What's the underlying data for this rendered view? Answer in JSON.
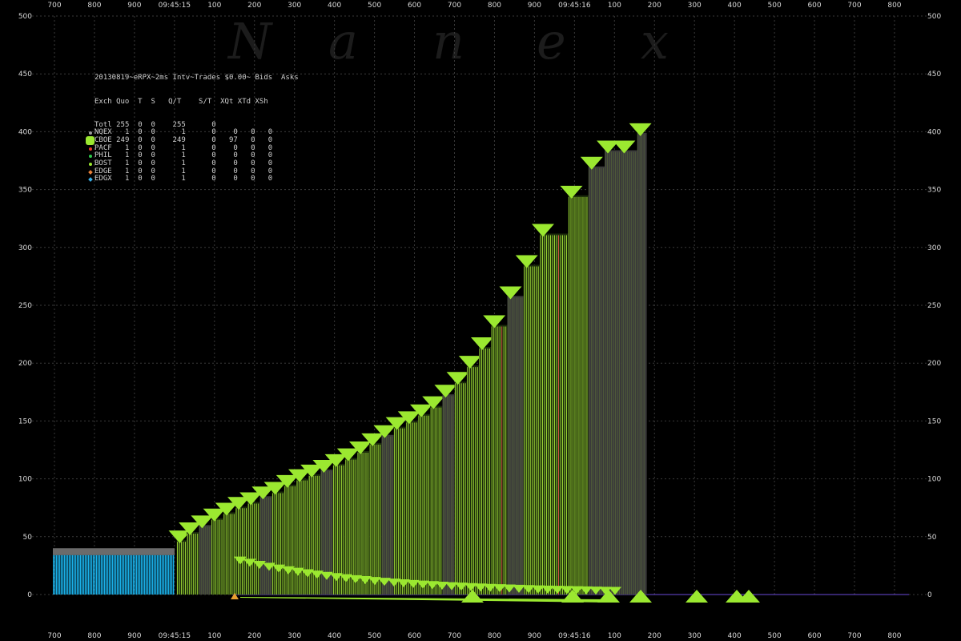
{
  "chart_data": {
    "type": "bar",
    "title": "20130819~eRPX~2ms Intv~Trades $0.00~ Bids  Asks",
    "watermark": [
      "N",
      "a",
      "n",
      "e",
      "x"
    ],
    "ylim": [
      0,
      500
    ],
    "yticks": [
      0,
      50,
      100,
      150,
      200,
      250,
      300,
      350,
      400,
      450,
      500
    ],
    "xticks_bottom": [
      "700",
      "800",
      "900",
      "09:45:15",
      "100",
      "200",
      "300",
      "400",
      "500",
      "600",
      "700",
      "800",
      "900",
      "09:45:16",
      "100",
      "200",
      "300",
      "400",
      "500",
      "600",
      "700",
      "800"
    ],
    "xticks_top": [
      "700",
      "800",
      "900",
      "09:45:15",
      "100",
      "200",
      "300",
      "400",
      "500",
      "600",
      "700",
      "800",
      "900",
      "09:45:16",
      "100",
      "200",
      "300",
      "400",
      "500",
      "600",
      "700",
      "800"
    ],
    "grid": true,
    "legend_position": "top-left",
    "colors": {
      "background": "#000000",
      "grid": "#3a3a3a",
      "bid_bars": "#1ab0e8",
      "bid_top": "#6b6b6b",
      "ask_bars": "#a8e83a",
      "ask_dark": "#3a3a3a",
      "ask_marker": "#9be830",
      "highlight": "#e85a4a"
    },
    "series": [
      {
        "name": "Bids",
        "x": [
          0,
          0.3
        ],
        "values": [
          34,
          34
        ]
      },
      {
        "name": "Asks",
        "x": [
          0.305,
          0.33,
          0.36,
          0.39,
          0.42,
          0.45,
          0.48,
          0.51,
          0.54,
          0.57,
          0.6,
          0.63,
          0.66,
          0.69,
          0.72,
          0.75,
          0.78,
          0.81,
          0.84,
          0.87,
          0.9,
          0.93,
          0.96,
          0.99,
          1.02,
          1.05,
          1.08,
          1.12,
          1.16,
          1.2,
          1.27,
          1.32,
          1.36,
          1.4,
          1.44
        ],
        "values": [
          47,
          54,
          60,
          66,
          71,
          76,
          80,
          85,
          89,
          95,
          100,
          104,
          108,
          113,
          118,
          124,
          131,
          138,
          145,
          150,
          156,
          163,
          173,
          184,
          198,
          214,
          233,
          258,
          285,
          312,
          345,
          370,
          384,
          384,
          399
        ]
      }
    ]
  },
  "legend": {
    "header": "Exch Quo  T  S   Q/T    S/T  XQt XTd XSh",
    "rows": [
      {
        "label": "Totl",
        "values": "255  0  0    255      0",
        "color": "",
        "marker": "none"
      },
      {
        "label": "NQEX",
        "values": "  1  0  0      1      0    0   0   0",
        "color": "#9a9a9a",
        "marker": "dot"
      },
      {
        "label": "CBOE",
        "values": "249  0  0    249      0   97   0   0",
        "color": "#9be830",
        "marker": "hex"
      },
      {
        "label": "PACF",
        "values": "  1  0  0      1      0    0   0   0",
        "color": "#e83a2a",
        "marker": "dot"
      },
      {
        "label": "PHIL",
        "values": "  1  0  0      1      0    0   0   0",
        "color": "#2ec84a",
        "marker": "dot"
      },
      {
        "label": "BOST",
        "values": "  1  0  0      1      0    0   0   0",
        "color": "#9be830",
        "marker": "dot"
      },
      {
        "label": "EDGE",
        "values": "  1  0  0      1      0    0   0   0",
        "color": "#e8803a",
        "marker": "dia"
      },
      {
        "label": "EDGX",
        "values": "  1  0  0      1      0    0   0   0",
        "color": "#3ab0e8",
        "marker": "dia"
      }
    ]
  }
}
